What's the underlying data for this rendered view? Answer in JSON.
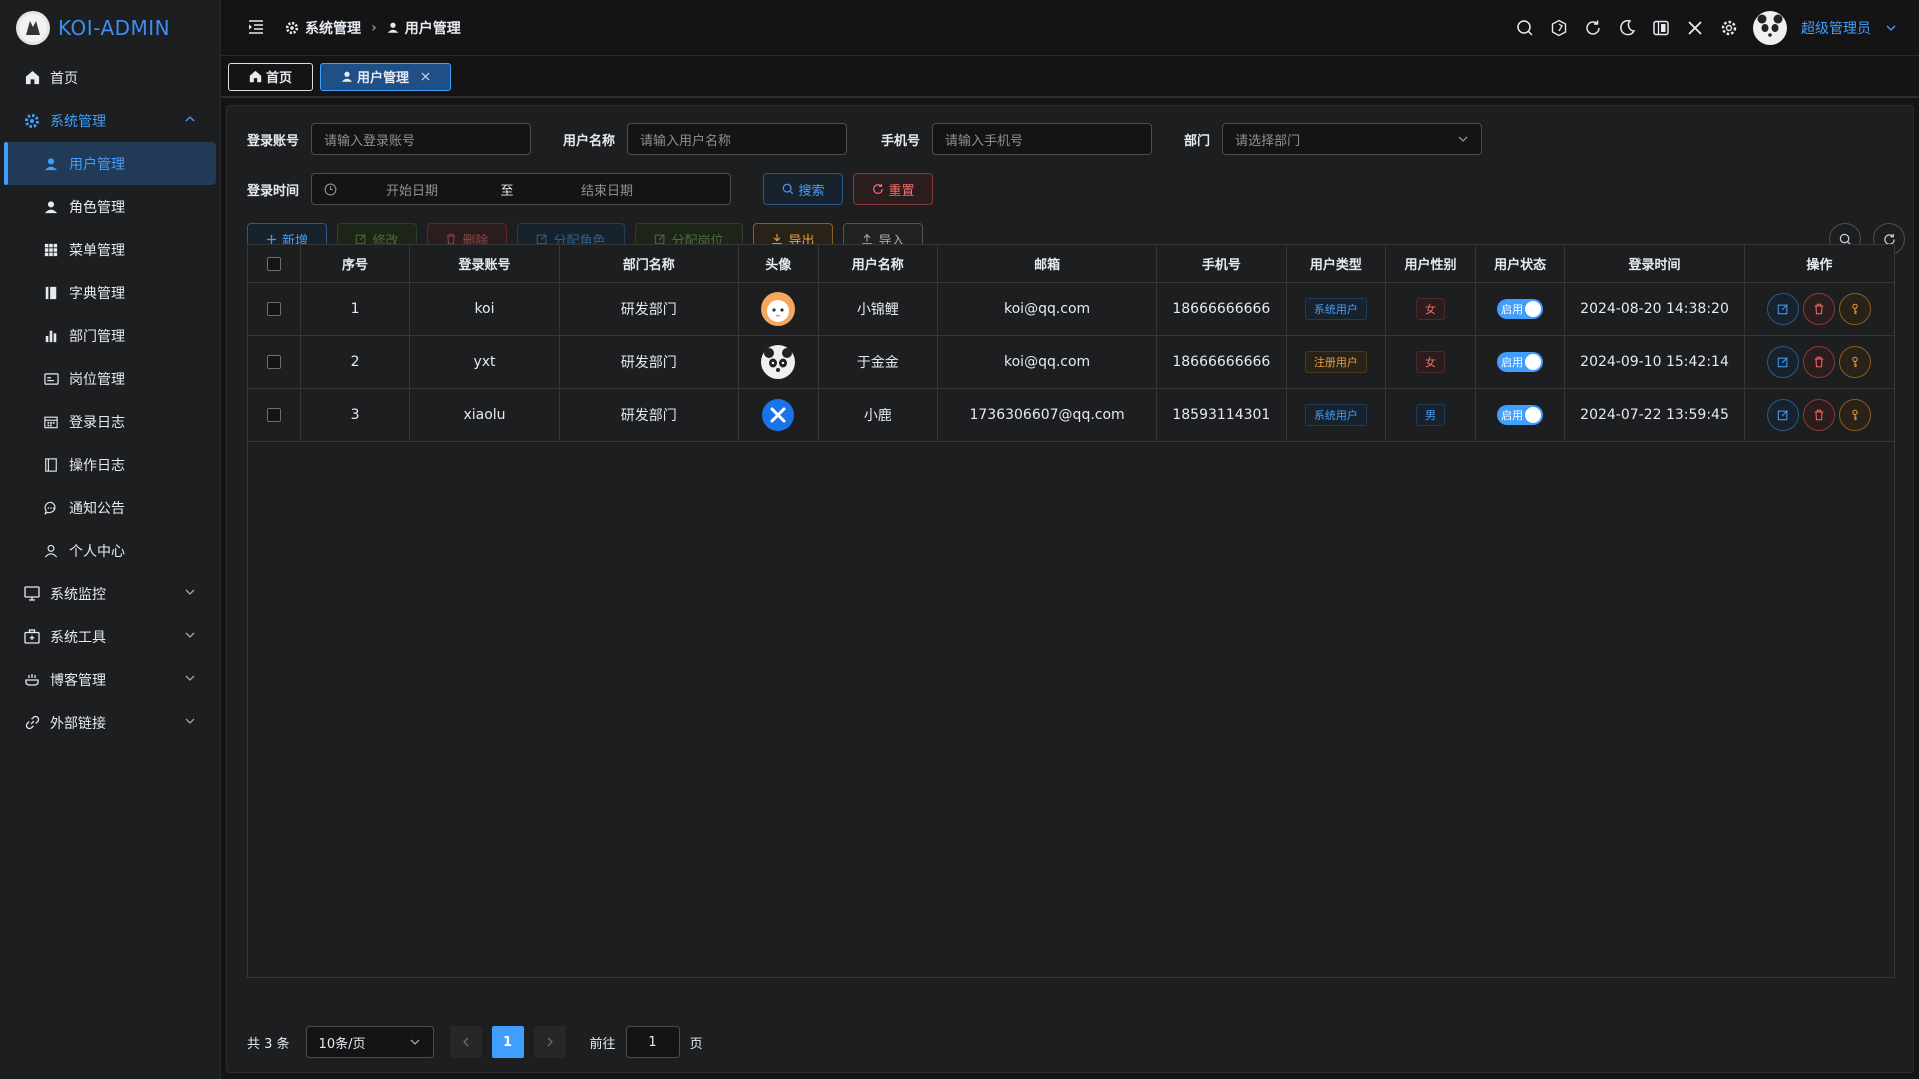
{
  "app": {
    "title": "KOI-ADMIN"
  },
  "sidebar": {
    "items": [
      {
        "label": "首页",
        "icon": "home-icon"
      },
      {
        "label": "系统管理",
        "icon": "gear-icon"
      },
      {
        "label": "用户管理",
        "icon": "user-icon"
      },
      {
        "label": "角色管理",
        "icon": "user-icon"
      },
      {
        "label": "菜单管理",
        "icon": "grid-icon"
      },
      {
        "label": "字典管理",
        "icon": "book-icon"
      },
      {
        "label": "部门管理",
        "icon": "bar-chart-icon"
      },
      {
        "label": "岗位管理",
        "icon": "id-card-icon"
      },
      {
        "label": "登录日志",
        "icon": "calendar-icon"
      },
      {
        "label": "操作日志",
        "icon": "notebook-icon"
      },
      {
        "label": "通知公告",
        "icon": "chat-icon"
      },
      {
        "label": "个人中心",
        "icon": "person-icon"
      },
      {
        "label": "系统监控",
        "icon": "monitor-icon"
      },
      {
        "label": "系统工具",
        "icon": "toolbox-icon"
      },
      {
        "label": "博客管理",
        "icon": "blog-icon"
      },
      {
        "label": "外部链接",
        "icon": "link-icon"
      }
    ]
  },
  "header": {
    "breadcrumb": [
      "系统管理",
      "用户管理"
    ],
    "username": "超级管理员"
  },
  "tabs": [
    {
      "label": "首页"
    },
    {
      "label": "用户管理"
    }
  ],
  "search": {
    "account_label": "登录账号",
    "account_placeholder": "请输入登录账号",
    "name_label": "用户名称",
    "name_placeholder": "请输入用户名称",
    "phone_label": "手机号",
    "phone_placeholder": "请输入手机号",
    "dept_label": "部门",
    "dept_placeholder": "请选择部门",
    "time_label": "登录时间",
    "start_placeholder": "开始日期",
    "range_sep": "至",
    "end_placeholder": "结束日期",
    "search_btn": "搜索",
    "reset_btn": "重置"
  },
  "toolbar": {
    "add": "新增",
    "edit": "修改",
    "delete": "删除",
    "assign_role": "分配角色",
    "assign_post": "分配岗位",
    "export": "导出",
    "import": "导入"
  },
  "table": {
    "headers": [
      "序号",
      "登录账号",
      "部门名称",
      "头像",
      "用户名称",
      "邮箱",
      "手机号",
      "用户类型",
      "用户性别",
      "用户状态",
      "登录时间",
      "操作"
    ],
    "rows": [
      {
        "idx": "1",
        "account": "koi",
        "dept": "研发部门",
        "avatar_style": "cat",
        "name": "小锦鲤",
        "email": "koi@qq.com",
        "phone": "18666666666",
        "type": "系统用户",
        "type_color": "primary",
        "gender": "女",
        "gender_color": "danger",
        "status": "启用",
        "time": "2024-08-20 14:38:20"
      },
      {
        "idx": "2",
        "account": "yxt",
        "dept": "研发部门",
        "avatar_style": "panda",
        "name": "于金金",
        "email": "koi@qq.com",
        "phone": "18666666666",
        "type": "注册用户",
        "type_color": "warning",
        "gender": "女",
        "gender_color": "danger",
        "status": "启用",
        "time": "2024-09-10 15:42:14"
      },
      {
        "idx": "3",
        "account": "xiaolu",
        "dept": "研发部门",
        "avatar_style": "x",
        "name": "小鹿",
        "email": "1736306607@qq.com",
        "phone": "18593114301",
        "type": "系统用户",
        "type_color": "primary",
        "gender": "男",
        "gender_color": "primary",
        "status": "启用",
        "time": "2024-07-22 13:59:45"
      }
    ]
  },
  "pagination": {
    "total_text": "共 3 条",
    "page_size": "10条/页",
    "current_page": "1",
    "goto_label": "前往",
    "goto_value": "1",
    "page_suffix": "页"
  },
  "colors": {
    "accent": "#409eff",
    "danger": "#f56c6c",
    "warning": "#e6a23c",
    "success": "#67c23a"
  }
}
